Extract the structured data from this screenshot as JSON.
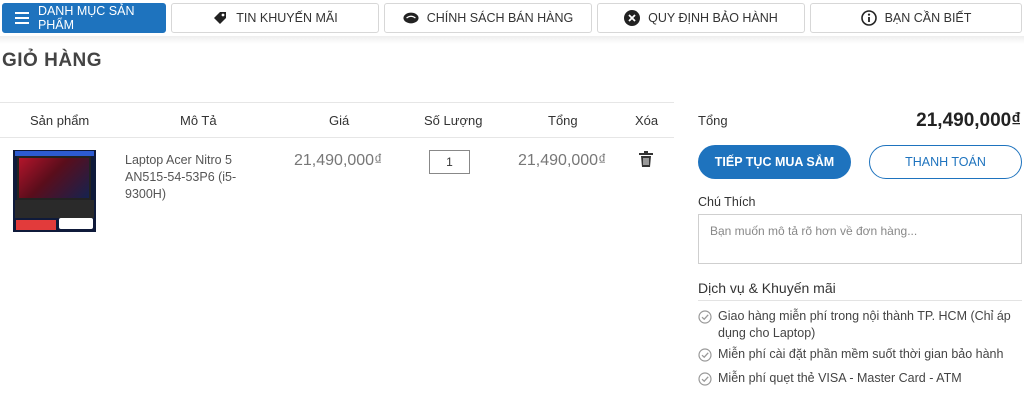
{
  "nav": {
    "items": [
      {
        "label": "DANH MỤC SẢN PHẨM",
        "icon": "menu-icon"
      },
      {
        "label": "TIN KHUYẾN MÃI",
        "icon": "tag-icon"
      },
      {
        "label": "CHÍNH SÁCH BÁN HÀNG",
        "icon": "handshake-icon"
      },
      {
        "label": "QUY ĐỊNH BẢO HÀNH",
        "icon": "wrench-icon"
      },
      {
        "label": "BẠN CẦN BIẾT",
        "icon": "info-icon"
      }
    ]
  },
  "page": {
    "title": "GIỎ HÀNG"
  },
  "cart": {
    "headers": {
      "product": "Sản phẩm",
      "description": "Mô Tả",
      "price": "Giá",
      "quantity": "Số Lượng",
      "total": "Tổng",
      "delete": "Xóa"
    },
    "items": [
      {
        "description": "Laptop Acer Nitro 5 AN515-54-53P6 (i5-9300H)",
        "price": "21,490,000₫",
        "quantity": "1",
        "total": "21,490,000₫"
      }
    ]
  },
  "summary": {
    "label": "Tổng",
    "value": "21,490,000₫",
    "continue_button": "TIẾP TỤC MUA SẮM",
    "pay_button": "THANH TOÁN",
    "note_label": "Chú Thích",
    "note_placeholder": "Bạn muốn mô tả rõ hơn về đơn hàng..."
  },
  "services": {
    "title": "Dịch vụ & Khuyến mãi",
    "items": [
      "Giao hàng miễn phí trong nội thành TP. HCM (Chỉ áp dụng cho Laptop)",
      "Miễn phí cài đặt phần mềm suốt thời gian bảo hành",
      "Miễn phí quẹt thẻ VISA - Master Card - ATM"
    ]
  },
  "colors": {
    "accent": "#1e73be",
    "text": "#333333",
    "muted": "#777777",
    "border": "#d7d7d7"
  }
}
